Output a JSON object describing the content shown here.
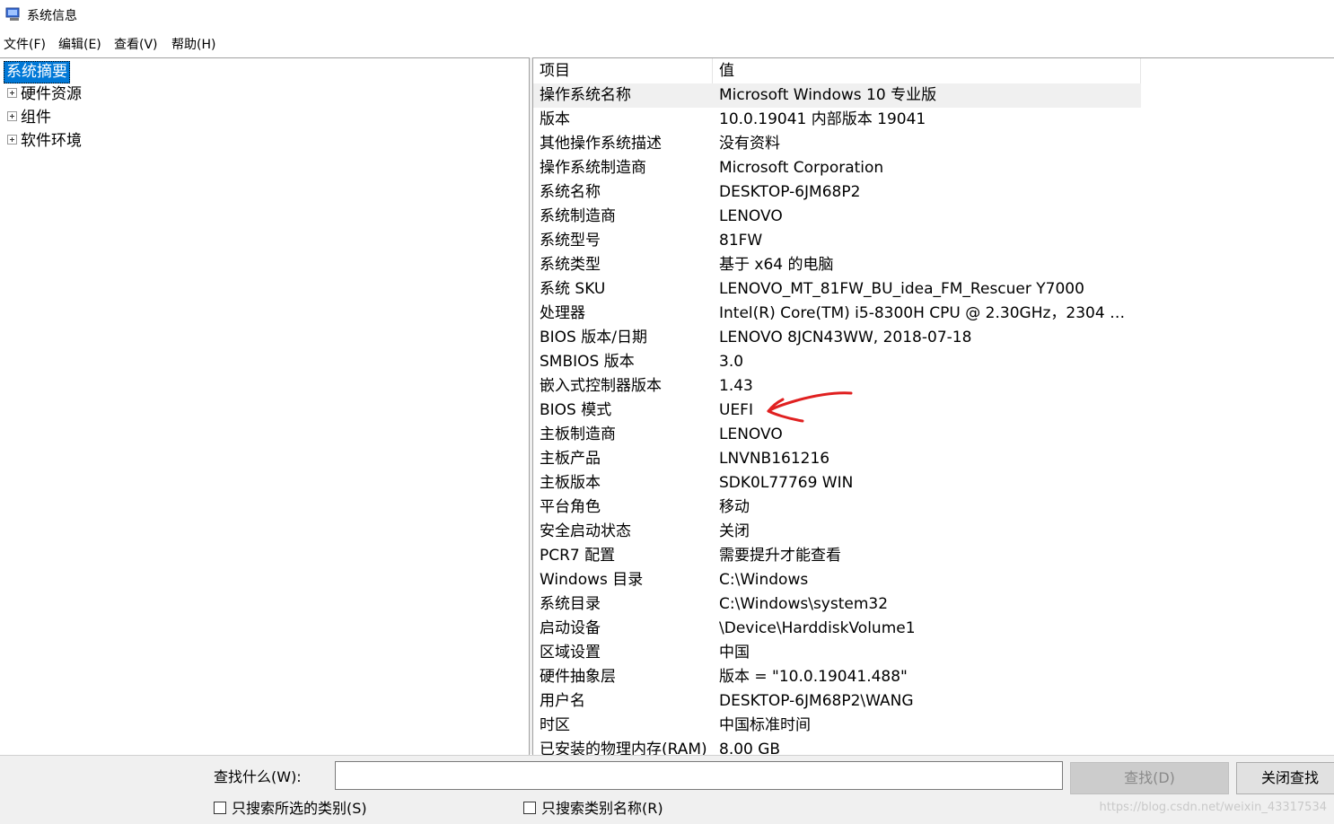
{
  "window": {
    "title": "系统信息"
  },
  "menu": [
    {
      "label": "文件(F)"
    },
    {
      "label": "编辑(E)"
    },
    {
      "label": "查看(V)"
    },
    {
      "label": "帮助(H)"
    }
  ],
  "tree": {
    "root": "系统摘要",
    "children": [
      {
        "label": "硬件资源"
      },
      {
        "label": "组件"
      },
      {
        "label": "软件环境"
      }
    ]
  },
  "table": {
    "columns": [
      "项目",
      "值"
    ],
    "rows": [
      {
        "name": "操作系统名称",
        "value": "Microsoft Windows 10 专业版"
      },
      {
        "name": "版本",
        "value": "10.0.19041 内部版本 19041"
      },
      {
        "name": "其他操作系统描述",
        "value": "没有资料"
      },
      {
        "name": "操作系统制造商",
        "value": "Microsoft Corporation"
      },
      {
        "name": "系统名称",
        "value": "DESKTOP-6JM68P2"
      },
      {
        "name": "系统制造商",
        "value": "LENOVO"
      },
      {
        "name": "系统型号",
        "value": "81FW"
      },
      {
        "name": "系统类型",
        "value": "基于 x64 的电脑"
      },
      {
        "name": "系统 SKU",
        "value": "LENOVO_MT_81FW_BU_idea_FM_Rescuer Y7000"
      },
      {
        "name": "处理器",
        "value": "Intel(R) Core(TM) i5-8300H CPU @ 2.30GHz，2304 Mh..."
      },
      {
        "name": "BIOS 版本/日期",
        "value": "LENOVO 8JCN43WW, 2018-07-18"
      },
      {
        "name": "SMBIOS 版本",
        "value": "3.0"
      },
      {
        "name": "嵌入式控制器版本",
        "value": "1.43"
      },
      {
        "name": "BIOS 模式",
        "value": "UEFI"
      },
      {
        "name": "主板制造商",
        "value": "LENOVO"
      },
      {
        "name": "主板产品",
        "value": "LNVNB161216"
      },
      {
        "name": "主板版本",
        "value": "SDK0L77769 WIN"
      },
      {
        "name": "平台角色",
        "value": "移动"
      },
      {
        "name": "安全启动状态",
        "value": "关闭"
      },
      {
        "name": "PCR7 配置",
        "value": "需要提升才能查看"
      },
      {
        "name": "Windows 目录",
        "value": "C:\\Windows"
      },
      {
        "name": "系统目录",
        "value": "C:\\Windows\\system32"
      },
      {
        "name": "启动设备",
        "value": "\\Device\\HarddiskVolume1"
      },
      {
        "name": "区域设置",
        "value": "中国"
      },
      {
        "name": "硬件抽象层",
        "value": "版本 = \"10.0.19041.488\""
      },
      {
        "name": "用户名",
        "value": "DESKTOP-6JM68P2\\WANG"
      },
      {
        "name": "时区",
        "value": "中国标准时间"
      },
      {
        "name": "已安装的物理内存(RAM)",
        "value": "8.00 GB"
      }
    ]
  },
  "search": {
    "label": "查找什么(W):",
    "value": "",
    "find_button": "查找(D)",
    "close_button": "关闭查找",
    "option_selected_only": "只搜索所选的类别(S)",
    "option_category_names": "只搜索类别名称(R)"
  },
  "watermark": "https://blog.csdn.net/weixin_43317534",
  "colors": {
    "selection": "#0078d7",
    "annotation": "#e02020"
  }
}
